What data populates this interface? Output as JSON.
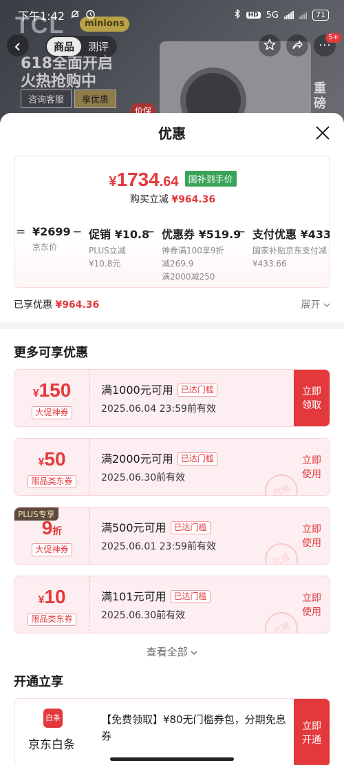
{
  "status_bar": {
    "time": "下午1:42",
    "network": "5G",
    "hd": "HD",
    "battery": "71"
  },
  "background": {
    "brand": "TCL",
    "collab": "minions",
    "promo_line1": "618全面开启",
    "promo_line2": "火热抢购中",
    "btn_service": "咨询客服",
    "btn_discount": "享优惠",
    "baojia": "价保",
    "side_text": "重磅"
  },
  "nav": {
    "tabs": [
      "商品",
      "测评"
    ],
    "badge": "5+"
  },
  "sheet": {
    "title": "优惠",
    "summary": {
      "final_price_yen": "¥",
      "final_price_int": "1734",
      "final_price_dec": ".64",
      "price_tag": "国补到手价",
      "reduce_label": "购买立减",
      "reduce_value": "¥964.36",
      "breakdown": [
        {
          "op": "=",
          "value": "¥2699",
          "desc": [
            "京东价"
          ]
        },
        {
          "op": "−",
          "value": "促销 ¥10.8",
          "desc": [
            "PLUS立减",
            "¥10.8元"
          ]
        },
        {
          "op": "−",
          "value": "优惠券 ¥519.9",
          "desc": [
            "神券满100享9折",
            "减269.9",
            "满2000减250"
          ]
        },
        {
          "op": "−",
          "value": "支付优惠 ¥433.66",
          "desc": [
            "国家补贴京东支付减",
            "¥433.66"
          ]
        }
      ]
    },
    "enjoyed_label": "已享优惠",
    "enjoyed_value": "¥964.36",
    "expand_label": "展开",
    "more_title": "更多可享优惠",
    "coupons": [
      {
        "yen": "¥",
        "amount": "150",
        "unit": "",
        "type": "大促神券",
        "plus": "",
        "condition": "满1000元可用",
        "reached": "已达门槛",
        "expiry": "2025.06.04 23:59前有效",
        "action": "立即领取",
        "stamp": ""
      },
      {
        "yen": "¥",
        "amount": "50",
        "unit": "",
        "type": "限品类东券",
        "plus": "",
        "condition": "满2000元可用",
        "reached": "已达门槛",
        "expiry": "2025.06.30前有效",
        "action": "立即使用",
        "stamp": "已领"
      },
      {
        "yen": "",
        "amount": "9",
        "unit": "折",
        "type": "大促神券",
        "plus": "PLUS专享",
        "condition": "满500元可用",
        "reached": "已达门槛",
        "expiry": "2025.06.01 23:59前有效",
        "action": "立即使用",
        "stamp": "已领"
      },
      {
        "yen": "¥",
        "amount": "10",
        "unit": "",
        "type": "限品类东券",
        "plus": "",
        "condition": "满101元可用",
        "reached": "已达门槛",
        "expiry": "2025.06.30前有效",
        "action": "立即使用",
        "stamp": "已领"
      }
    ],
    "view_all": "查看全部",
    "open_title": "开通立享",
    "open_card": {
      "logo_text": "白条",
      "name": "京东白条",
      "desc": "【免费领取】¥80无门槛券包，分期免息券",
      "action": "立即开通"
    }
  },
  "colors": {
    "accent_red": "#e4393c",
    "tag_green": "#3aa35a",
    "coupon_bg": "#fdeff1"
  }
}
